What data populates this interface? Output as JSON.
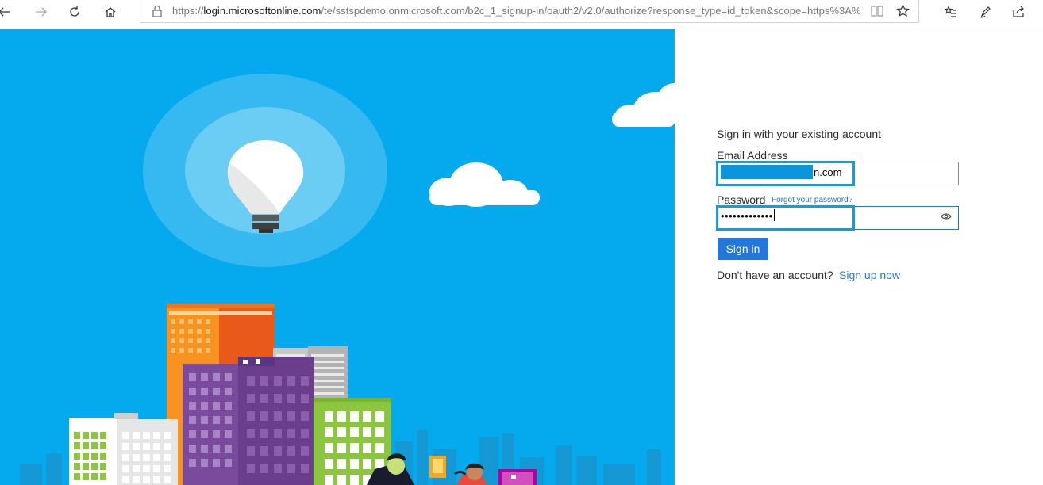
{
  "browser": {
    "url_prefix": "https://",
    "url_host": "login.microsoftonline.com",
    "url_rest": "/te/sstspdemo.onmicrosoft.com/b2c_1_signup-in/oauth2/v2.0/authorize?response_type=id_token&scope=https%3A%",
    "icons": [
      "back-icon",
      "forward-icon",
      "refresh-icon",
      "home-icon",
      "lock-icon",
      "reading-view-icon",
      "favorite-star-icon",
      "favorites-hub-icon",
      "pen-icon",
      "share-icon"
    ]
  },
  "signin": {
    "heading": "Sign in with your existing account",
    "email_label": "Email Address",
    "email_value_visible": "n.com",
    "password_label": "Password",
    "forgot_link": "Forgot your password?",
    "password_masked": "•••••••••••••",
    "button": "Sign in",
    "no_account_text": "Don't have an account?",
    "signup_link": "Sign up now"
  },
  "colors": {
    "hero_background": "#04a9ee",
    "button": "#2477d9",
    "link": "#1e6ec8",
    "focus_ring": "#1b9ad6"
  }
}
